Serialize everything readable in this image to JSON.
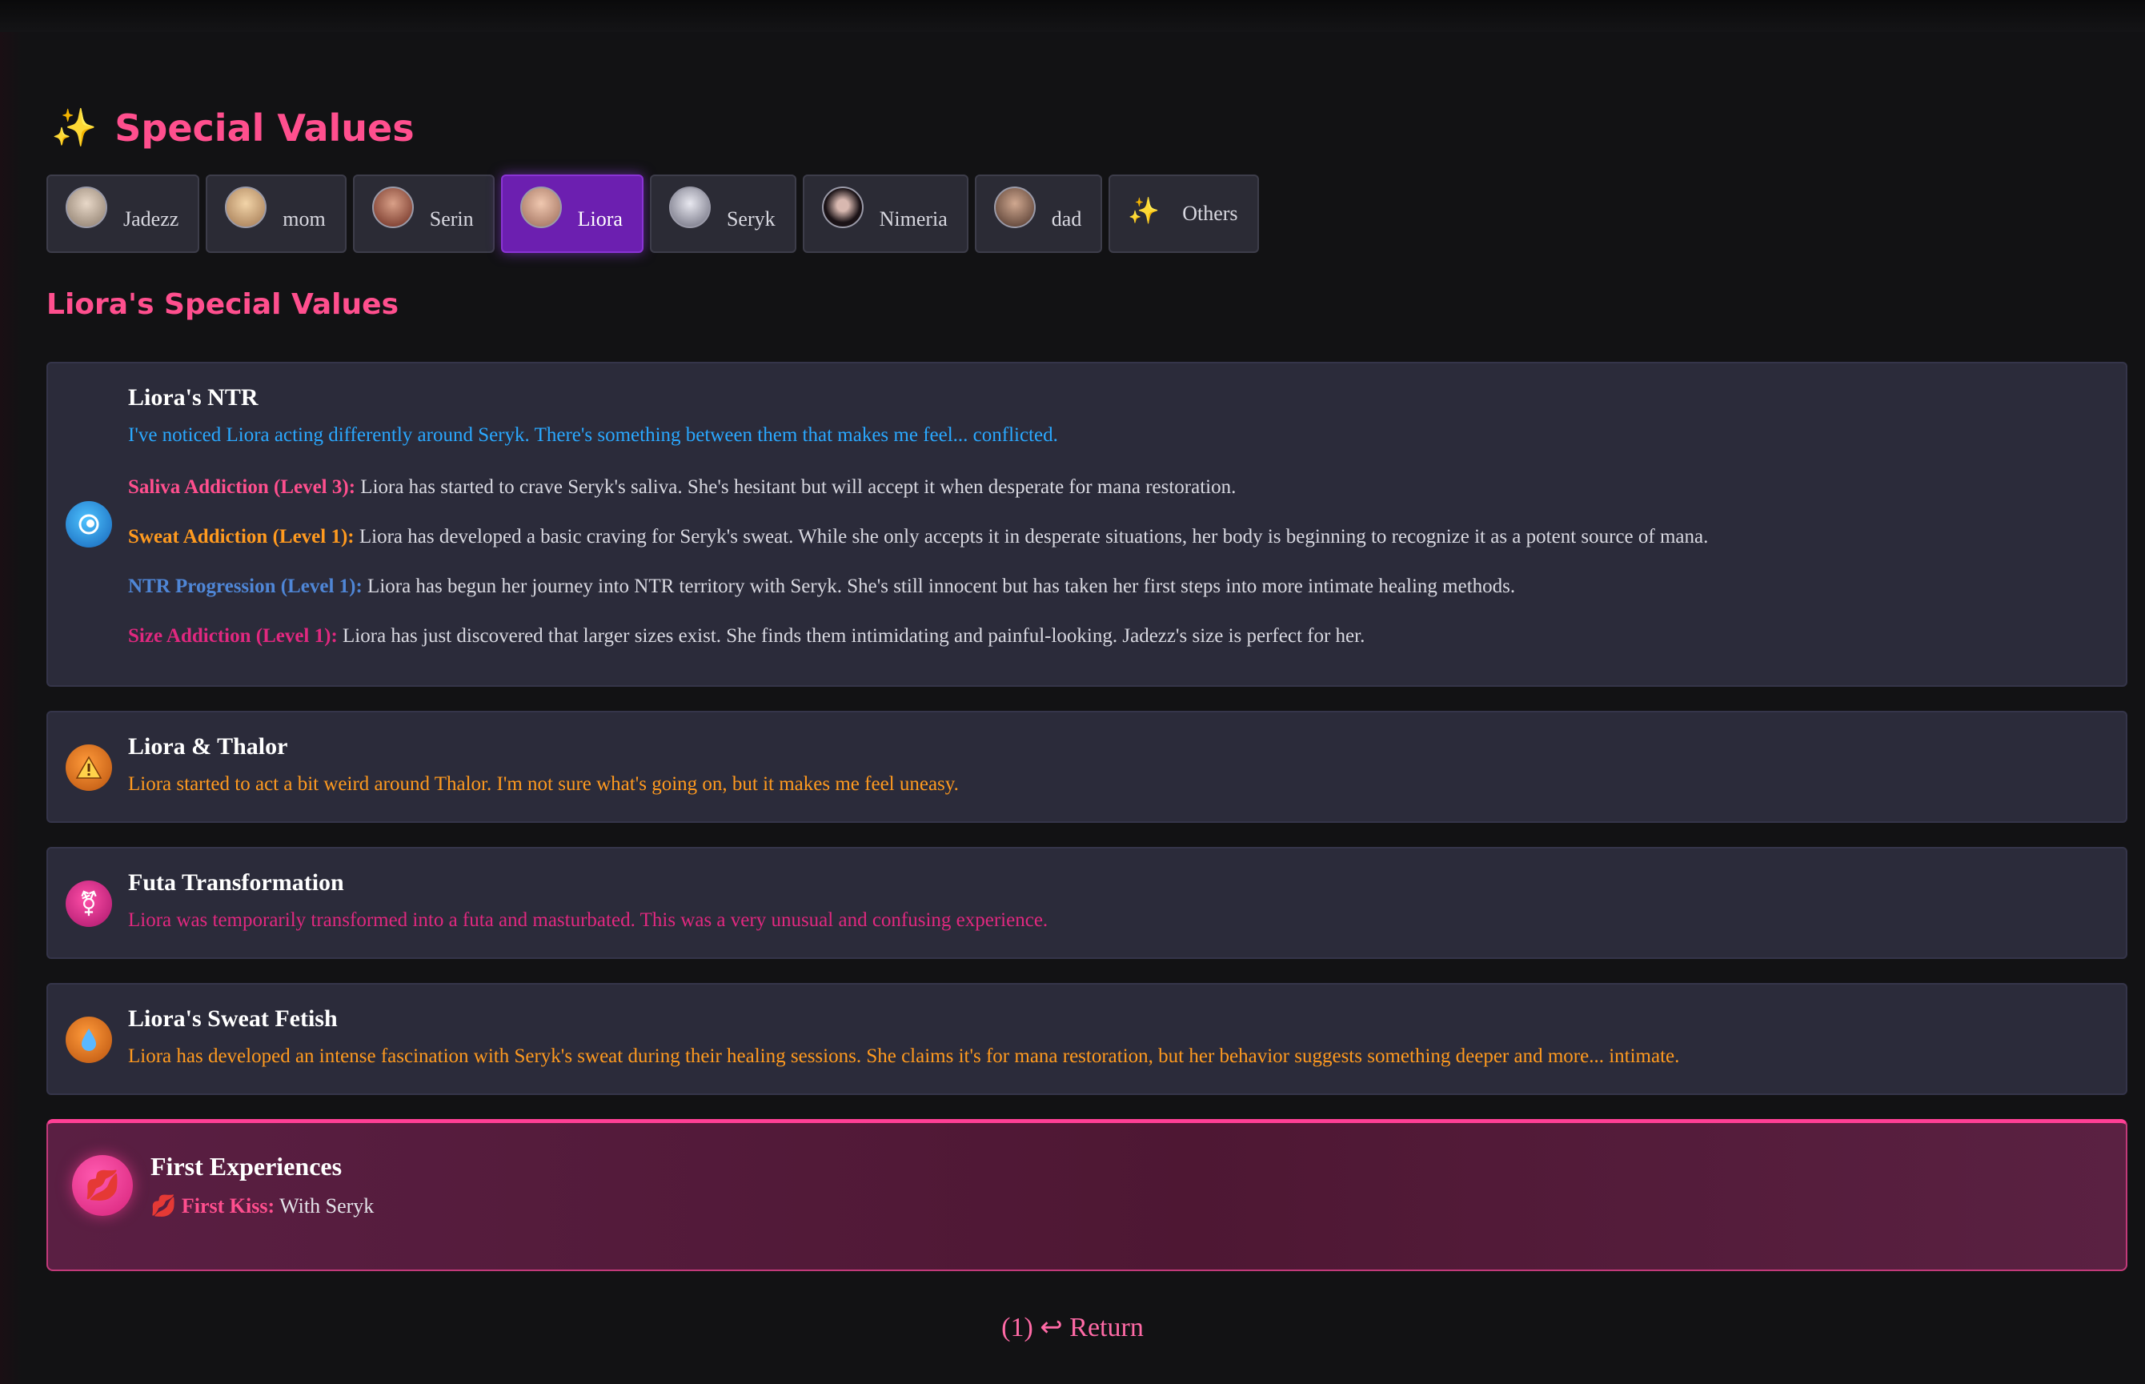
{
  "page": {
    "title": "Special Values",
    "title_icon": "sparkles-icon"
  },
  "tabs": [
    {
      "label": "Jadezz",
      "avatar_color": "#c9b7a6"
    },
    {
      "label": "mom",
      "avatar_color": "#d6b48c"
    },
    {
      "label": "Serin",
      "avatar_color": "#8a4a3a"
    },
    {
      "label": "Liora",
      "avatar_color": "#c89a86",
      "active": true
    },
    {
      "label": "Seryk",
      "avatar_color": "#b8b8c4"
    },
    {
      "label": "Nimeria",
      "avatar_color": "#2a1c24"
    },
    {
      "label": "dad",
      "avatar_color": "#8a6a58"
    },
    {
      "label": "Others",
      "icon": "sparkles-icon"
    }
  ],
  "section": {
    "title": "Liora's Special Values"
  },
  "cards": {
    "ntr": {
      "title": "Liora's NTR",
      "subtitle": "I've noticed Liora acting differently around Seryk. There's something between them that makes me feel... conflicted.",
      "effects": [
        {
          "key": "Saliva Addiction (Level 3):",
          "text": " Liora has started to crave Seryk's saliva. She's hesitant but will accept it when desperate for mana restoration.",
          "color": "#ff4f8e"
        },
        {
          "key": "Sweat Addiction (Level 1):",
          "text": " Liora has developed a basic craving for Seryk's sweat. While she only accepts it in desperate situations, her body is beginning to recognize it as a potent source of mana.",
          "color": "#ff9a1f"
        },
        {
          "key": "NTR Progression (Level 1):",
          "text": " Liora has begun her journey into NTR territory with Seryk. She's still innocent but has taken her first steps into more intimate healing methods.",
          "color": "#4f86d6"
        },
        {
          "key": "Size Addiction (Level 1):",
          "text": " Liora has just discovered that larger sizes exist. She finds them intimidating and painful-looking. Jadezz's size is perfect for her.",
          "color": "#e0287f"
        }
      ]
    },
    "thalor": {
      "title": "Liora & Thalor",
      "text": "Liora started to act a bit weird around Thalor. I'm not sure what's going on, but it makes me feel uneasy."
    },
    "futa": {
      "title": "Futa Transformation",
      "text": "Liora was temporarily transformed into a futa and masturbated. This was a very unusual and confusing experience."
    },
    "sweat": {
      "title": "Liora's Sweat Fetish",
      "text": "Liora has developed an intense fascination with Seryk's sweat during their healing sessions. She claims it's for mana restoration, but her behavior suggests something deeper and more... intimate."
    },
    "first": {
      "title": "First Experiences",
      "kiss_label": "First Kiss:",
      "kiss_value": " With Seryk"
    }
  },
  "colors": {
    "accent_pink": "#ff4f8e",
    "subtitle_blue": "#2aa8ff",
    "warning_orange": "#ff9a1f",
    "futa_pink": "#e0287f"
  },
  "footer": {
    "return_label": "(1) ↩ Return"
  }
}
